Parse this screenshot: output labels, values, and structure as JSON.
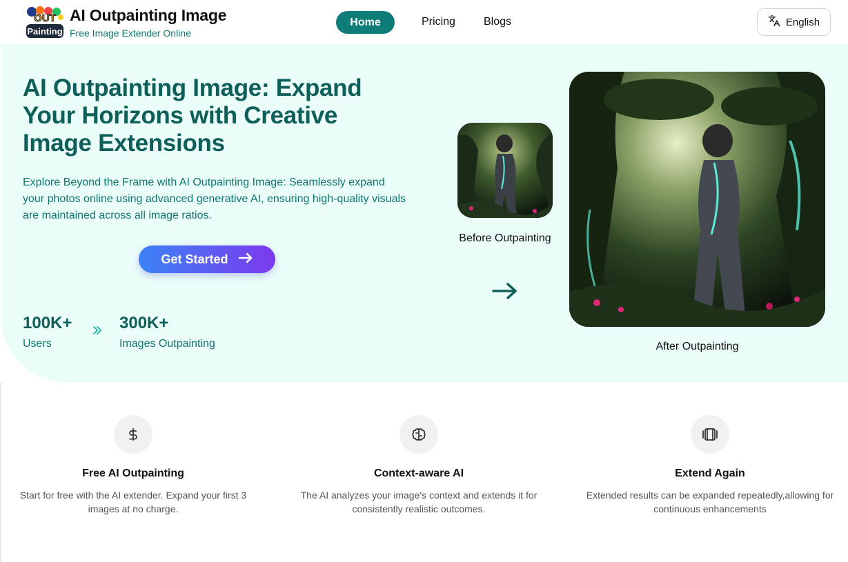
{
  "header": {
    "brand_title": "AI Outpainting Image",
    "brand_subtitle": "Free Image Extender Online",
    "logo_text_top": "OUT",
    "logo_text_bottom": "Painting",
    "nav": {
      "home": "Home",
      "pricing": "Pricing",
      "blogs": "Blogs"
    },
    "language": "English"
  },
  "hero": {
    "title": "AI Outpainting Image: Expand Your Horizons with Creative Image Extensions",
    "description": "Explore Beyond the Frame with AI Outpainting Image: Seamlessly expand your photos online using advanced generative AI, ensuring high-quality visuals are maintained across all image ratios.",
    "cta": "Get Started",
    "stats": [
      {
        "value": "100K+",
        "label": "Users"
      },
      {
        "value": "300K+",
        "label": "Images Outpainting"
      }
    ],
    "before_caption": "Before Outpainting",
    "after_caption": "After Outpainting"
  },
  "features": [
    {
      "icon": "dollar-icon",
      "title": "Free AI Outpainting",
      "description": "Start for free with the AI extender. Expand your first 3 images at no charge."
    },
    {
      "icon": "brain-icon",
      "title": "Context-aware AI",
      "description": "The AI analyzes your image's context and extends it for consistently realistic outcomes."
    },
    {
      "icon": "layers-icon",
      "title": "Extend Again",
      "description": "Extended results can be expanded repeatedly,allowing for continuous enhancements"
    }
  ],
  "colors": {
    "accent": "#0f7d77",
    "hero_bg": "#ebfdf8",
    "title_teal": "#0e5e59",
    "cta_gradient_start": "#3b82f6",
    "cta_gradient_end": "#7c3aed"
  }
}
